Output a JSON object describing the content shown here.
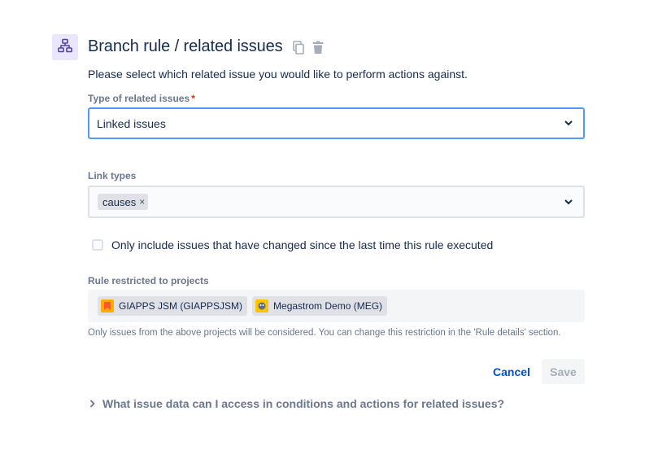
{
  "header": {
    "title": "Branch rule / related issues",
    "icon": "branch-hierarchy-icon",
    "actions": [
      {
        "icon": "copy-icon"
      },
      {
        "icon": "trash-icon"
      }
    ]
  },
  "description": "Please select which related issue you would like to perform actions against.",
  "related_type": {
    "label": "Type of related issues",
    "required_marker": "*",
    "value": "Linked issues"
  },
  "link_types": {
    "label": "Link types",
    "selected": [
      "causes"
    ],
    "remove_glyph": "×"
  },
  "only_changed": {
    "checked": false,
    "label": "Only include issues that have changed since the last time this rule executed"
  },
  "projects": {
    "label": "Rule restricted to projects",
    "items": [
      {
        "name": "GIAPPS JSM (GIAPPSJSM)",
        "avatar_color": "#ff5630"
      },
      {
        "name": "Megastrom Demo (MEG)",
        "avatar_color": "#ffc400"
      }
    ],
    "helper": "Only issues from the above projects will be considered. You can change this restriction in the 'Rule details' section."
  },
  "buttons": {
    "cancel": "Cancel",
    "save": "Save"
  },
  "help_expander": "What issue data can I access in conditions and actions for related issues?",
  "colors": {
    "accent": "#0052cc",
    "focus_border": "#4c9aff",
    "icon_bg": "#eae6ff",
    "icon_fg": "#5243aa"
  }
}
